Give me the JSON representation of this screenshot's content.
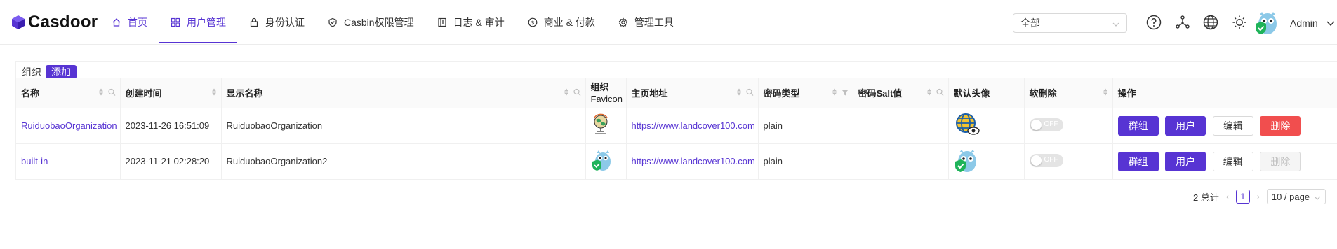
{
  "brand": {
    "name": "Casdoor"
  },
  "nav": [
    {
      "label": "首页",
      "icon": "home-icon"
    },
    {
      "label": "用户管理",
      "icon": "grid-icon",
      "active": true
    },
    {
      "label": "身份认证",
      "icon": "lock-icon"
    },
    {
      "label": "Casbin权限管理",
      "icon": "shield-icon"
    },
    {
      "label": "日志 & 审计",
      "icon": "log-icon"
    },
    {
      "label": "商业 & 付款",
      "icon": "dollar-icon"
    },
    {
      "label": "管理工具",
      "icon": "gear-icon"
    }
  ],
  "header": {
    "org_select_value": "全部",
    "user_name": "Admin"
  },
  "card": {
    "title": "组织",
    "add_label": "添加"
  },
  "table": {
    "columns": [
      "名称",
      "创建时间",
      "显示名称",
      "组织\nFavicon",
      "主页地址",
      "密码类型",
      "密码Salt值",
      "默认头像",
      "软删除",
      "操作"
    ],
    "favicon_col": {
      "line1": "组织",
      "line2": "Favicon"
    },
    "rows": [
      {
        "name": "RuiduobaoOrganization",
        "created": "2023-11-26 16:51:09",
        "display": "RuiduobaoOrganization",
        "homepage": "https://www.landcover100.com",
        "pwd_type": "plain",
        "salt": "",
        "soft_delete": "OFF",
        "actions": {
          "groups": "群组",
          "users": "用户",
          "edit": "编辑",
          "delete": "删除"
        }
      },
      {
        "name": "built-in",
        "created": "2023-11-21 02:28:20",
        "display": "RuiduobaoOrganization2",
        "homepage": "https://www.landcover100.com",
        "pwd_type": "plain",
        "salt": "",
        "soft_delete": "OFF",
        "actions": {
          "groups": "群组",
          "users": "用户",
          "edit": "编辑",
          "delete": "删除"
        }
      }
    ]
  },
  "pagination": {
    "total": "2 总计",
    "current": "1",
    "page_size": "10 / page"
  },
  "colors": {
    "accent": "#5734d3",
    "danger": "#f14e4e"
  }
}
